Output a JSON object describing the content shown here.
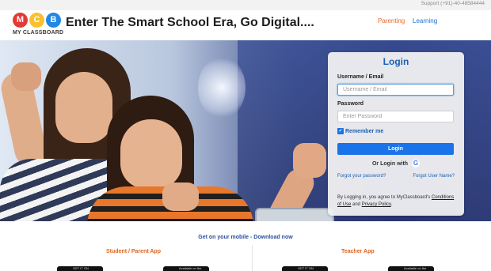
{
  "topbar": {
    "support": "Support  (+91)-40-48584444"
  },
  "header": {
    "logo_letters": [
      "M",
      "C",
      "B"
    ],
    "brand": "MY CLASSBOARD",
    "tagline": "Enter The Smart School Era, Go Digital....",
    "nav": [
      "Parenting",
      "Learning"
    ]
  },
  "login": {
    "title": "Login",
    "username_label": "Username / Email",
    "username_placeholder": "Username / Email",
    "password_label": "Password",
    "password_placeholder": "Enter Password",
    "remember_label": "Remember me",
    "remember_checked": true,
    "login_button": "Login",
    "or_login_with": "Or Login with",
    "google_glyph": "G",
    "forgot_password": "Forgot your password?",
    "forgot_username": "Forgot User Name?",
    "terms_prefix": "By Logging in, you agree to MyClassboard's ",
    "conditions_link": "Conditions of Use",
    "terms_and": " and ",
    "privacy_link": "Privacy Policy",
    "terms_suffix": "."
  },
  "download": {
    "title": "Get on your mobile - Download now",
    "student_app": "Student / Parent App",
    "teacher_app": "Teacher App",
    "badges": [
      "GET IT ON",
      "Available on the",
      "GET IT ON",
      "Available on the"
    ]
  },
  "colors": {
    "brand_blue": "#1a5fb4",
    "button_blue": "#1a73e8",
    "accent_orange": "#e0641f"
  }
}
